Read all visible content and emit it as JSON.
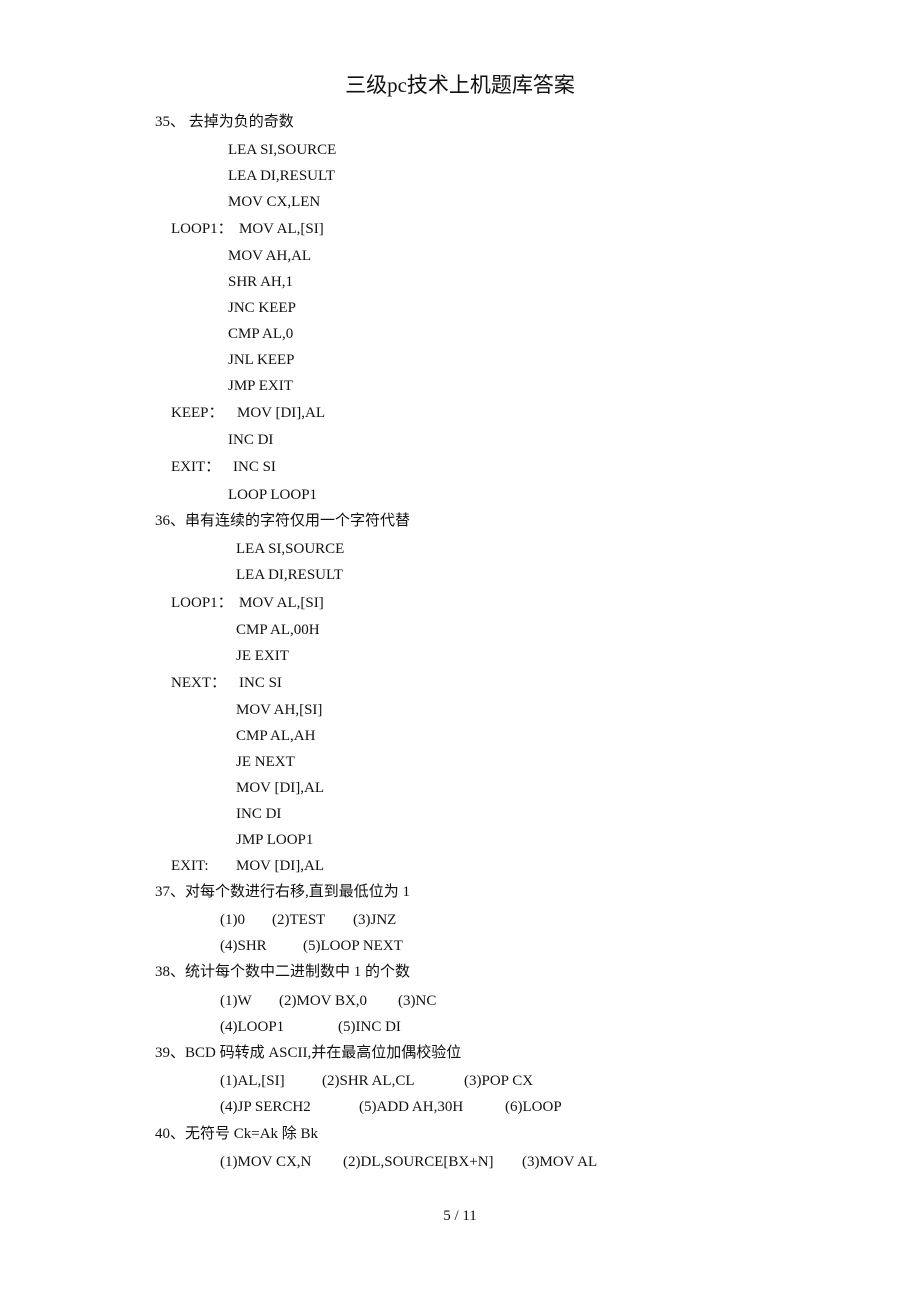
{
  "document": {
    "title": "三级pc技术上机题库答案",
    "page_indicator": "5  / 11"
  },
  "q35": {
    "heading": "35、 去掉为负的奇数",
    "lines": [
      {
        "label": "",
        "code": "LEA SI,SOURCE"
      },
      {
        "label": "",
        "code": "LEA DI,RESULT"
      },
      {
        "label": "",
        "code": "MOV CX,LEN"
      },
      {
        "label": "LOOP1：",
        "code": "MOV AL,[SI]"
      },
      {
        "label": "",
        "code": "MOV AH,AL"
      },
      {
        "label": "",
        "code": "SHR AH,1"
      },
      {
        "label": "",
        "code": "JNC KEEP"
      },
      {
        "label": "",
        "code": "CMP AL,0"
      },
      {
        "label": "",
        "code": "JNL KEEP"
      },
      {
        "label": "",
        "code": "JMP EXIT"
      },
      {
        "label": "KEEP：",
        "code": "MOV [DI],AL"
      },
      {
        "label": "",
        "code": "INC DI"
      },
      {
        "label": "EXIT：",
        "code": "INC SI"
      },
      {
        "label": "",
        "code": "LOOP LOOP1"
      }
    ]
  },
  "q36": {
    "heading": "36、串有连续的字符仅用一个字符代替",
    "lines": [
      {
        "label": "",
        "code": "LEA SI,SOURCE"
      },
      {
        "label": "",
        "code": "LEA DI,RESULT"
      },
      {
        "label": "LOOP1：",
        "code": "MOV AL,[SI]"
      },
      {
        "label": "",
        "code": "CMP AL,00H"
      },
      {
        "label": "",
        "code": "JE EXIT"
      },
      {
        "label": "NEXT：",
        "code": "INC SI"
      },
      {
        "label": "",
        "code": "MOV AH,[SI]"
      },
      {
        "label": "",
        "code": "CMP AL,AH"
      },
      {
        "label": "",
        "code": "JE NEXT"
      },
      {
        "label": "",
        "code": "MOV [DI],AL"
      },
      {
        "label": "",
        "code": "INC DI"
      },
      {
        "label": "",
        "code": "JMP LOOP1"
      },
      {
        "label": "EXIT:",
        "code": "MOV [DI],AL"
      }
    ]
  },
  "q37": {
    "heading": "37、对每个数进行右移,直到最低位为 1",
    "rows": [
      [
        "(1)0",
        "(2)TEST",
        "(3)JNZ"
      ],
      [
        "(4)SHR",
        "(5)LOOP NEXT"
      ]
    ]
  },
  "q38": {
    "heading": "38、统计每个数中二进制数中 1 的个数",
    "rows": [
      [
        "(1)W",
        "(2)MOV BX,0",
        "(3)NC"
      ],
      [
        "(4)LOOP1",
        "(5)INC DI"
      ]
    ]
  },
  "q39": {
    "heading": "39、BCD 码转成 ASCII,并在最高位加偶校验位",
    "rows": [
      [
        "(1)AL,[SI]",
        "(2)SHR AL,CL",
        "(3)POP CX"
      ],
      [
        "(4)JP SERCH2",
        "(5)ADD AH,30H",
        "(6)LOOP"
      ]
    ]
  },
  "q40": {
    "heading": "40、无符号 Ck=Ak 除 Bk",
    "rows": [
      [
        "(1)MOV CX,N",
        "(2)DL,SOURCE[BX+N]",
        "(3)MOV AL"
      ]
    ]
  }
}
